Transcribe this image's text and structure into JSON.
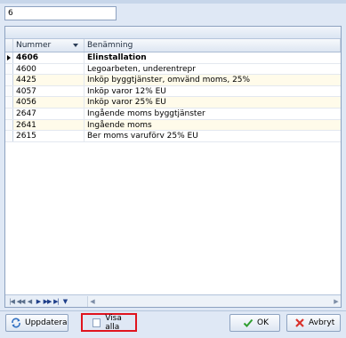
{
  "search": {
    "value": "6"
  },
  "grid": {
    "columns": {
      "number": "Nummer",
      "name": "Benämning"
    },
    "rows": [
      {
        "number": "4606",
        "name": "Elinstallation",
        "selected": true
      },
      {
        "number": "4600",
        "name": "Legoarbeten, underentrepr"
      },
      {
        "number": "4425",
        "name": "Inköp byggtjänster, omvänd moms, 25%"
      },
      {
        "number": "4057",
        "name": "Inköp varor 12% EU"
      },
      {
        "number": "4056",
        "name": "Inköp varor 25% EU"
      },
      {
        "number": "2647",
        "name": "Ingående moms byggtjänster"
      },
      {
        "number": "2641",
        "name": "Ingående moms"
      },
      {
        "number": "2615",
        "name": "Ber moms varuförv 25% EU"
      }
    ]
  },
  "navigator": {
    "icons": [
      "first-icon",
      "prev-page-icon",
      "prev-icon",
      "next-icon",
      "next-page-icon",
      "last-icon",
      "filter-icon"
    ]
  },
  "footer": {
    "refresh_label": "Uppdatera",
    "show_all_label": "Visa alla",
    "show_all_checked": false,
    "ok_label": "OK",
    "cancel_label": "Avbryt"
  },
  "colors": {
    "highlight_border": "#e0141e",
    "cancel_icon": "#d9322b",
    "ok_icon": "#2f9e2f",
    "refresh_icon": "#2f6fc2"
  }
}
